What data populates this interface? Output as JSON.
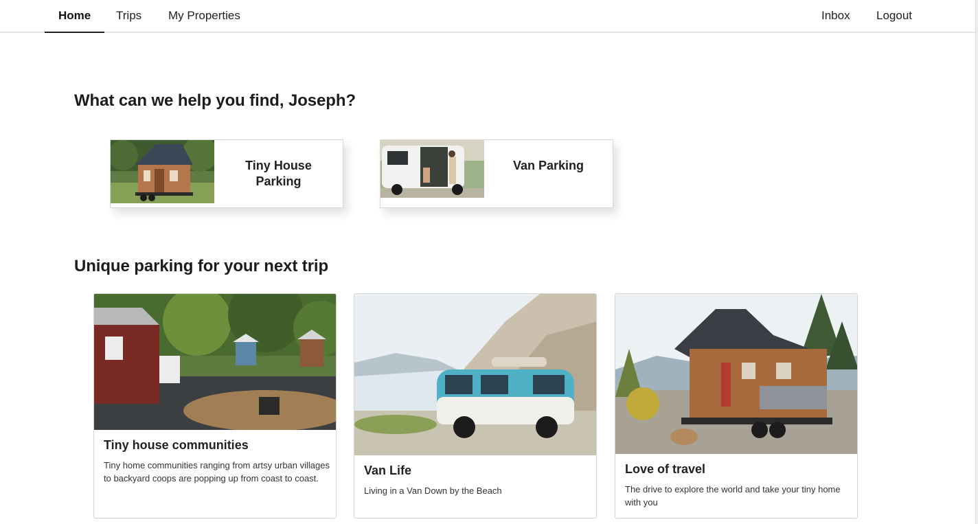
{
  "nav": {
    "home": "Home",
    "trips": "Trips",
    "my_properties": "My Properties",
    "inbox": "Inbox",
    "logout": "Logout"
  },
  "greeting": "What can we help you find, Joseph?",
  "categories": [
    {
      "label": "Tiny House Parking",
      "image": "tiny-house-photo"
    },
    {
      "label": "Van Parking",
      "image": "camper-van-photo"
    }
  ],
  "section_title": "Unique parking for your next trip",
  "trips": [
    {
      "title": "Tiny house communities",
      "description": "Tiny home communities ranging from artsy urban villages to backyard coops are popping up from coast to coast.",
      "image": "tiny-house-village-photo"
    },
    {
      "title": "Van Life",
      "description": "Living in a Van Down by the Beach",
      "image": "vw-bus-cliff-photo"
    },
    {
      "title": "Love of travel",
      "description": "The drive to explore the world and take your tiny home with you",
      "image": "tiny-house-trailer-photo"
    }
  ],
  "colors": {
    "nav_underline": "#222222",
    "border": "#d4d4d4",
    "text": "#1c1c1c"
  }
}
